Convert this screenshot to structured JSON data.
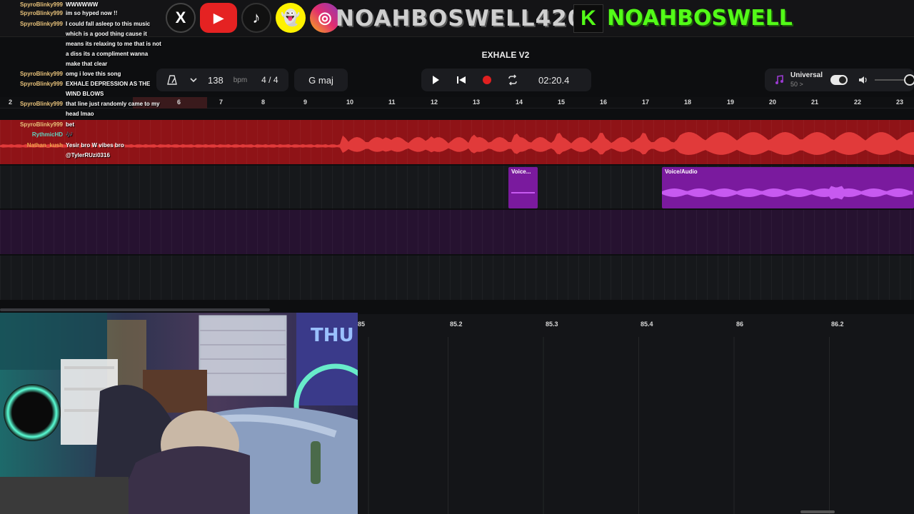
{
  "social": {
    "x_icon": "X",
    "youtube_icon": "▶",
    "tiktok_icon": "♪",
    "snapchat_icon": "👻",
    "instagram_icon": "◎",
    "handle": "NOAHBOSWELL420",
    "kick_icon": "K",
    "kick_handle": "NOAHBOSWELL"
  },
  "project": {
    "title": "EXHALE V2"
  },
  "toolbar": {
    "metronome_icon": "metronome-icon",
    "bpm": "138",
    "bpm_unit": "bpm",
    "time_sig": "4 / 4",
    "key": "G maj",
    "time": "02:20.4",
    "universal_label": "Universal",
    "universal_sub": "50 >"
  },
  "ruler": {
    "numbers": [
      "2",
      "6",
      "7",
      "8",
      "9",
      "10",
      "11",
      "12",
      "13",
      "14",
      "15",
      "16",
      "17",
      "18",
      "19",
      "20",
      "21",
      "22",
      "23"
    ]
  },
  "tracks": {
    "clip_1": "Voice...",
    "clip_2": "Voice/Audio"
  },
  "editor": {
    "ruler": [
      "85",
      "85.2",
      "85.3",
      "85.4",
      "86",
      "86.2"
    ]
  },
  "chat": {
    "messages": [
      {
        "user": "SpyroBlinky999",
        "text": "WWWWWW"
      },
      {
        "user": "SpyroBlinky999",
        "text": "im so hyped now !!"
      },
      {
        "user": "SpyroBlinky999",
        "text": "I could fall asleep to this music which is a good thing cause it means its relaxing to me that is not a diss its a compliment wanna make that clear"
      },
      {
        "user": "SpyroBlinky999",
        "text": "omg i love this song"
      },
      {
        "user": "SpyroBlinky999",
        "text": "EXHALE DEPRESSION AS THE WIND BLOWS"
      },
      {
        "user": "SpyroBlinky999",
        "text": "that line just randomly came to my head lmao"
      },
      {
        "user": "SpyroBlinky999",
        "text": "bet"
      },
      {
        "user": "RythmicHD",
        "text": "🎶"
      },
      {
        "user": "Nathan_kush",
        "text": "Yesir bro W vibes bro @TylerRUzi0316"
      }
    ],
    "overlay_id": "90149c4b-3d11-8e54-6045b-d254c91"
  },
  "colors": {
    "accent_red": "#d32f2f",
    "clip_purple": "#7a1a9e",
    "kick_green": "#53fc18",
    "youtube_red": "#e52222",
    "snapchat_yellow": "#fff200"
  }
}
